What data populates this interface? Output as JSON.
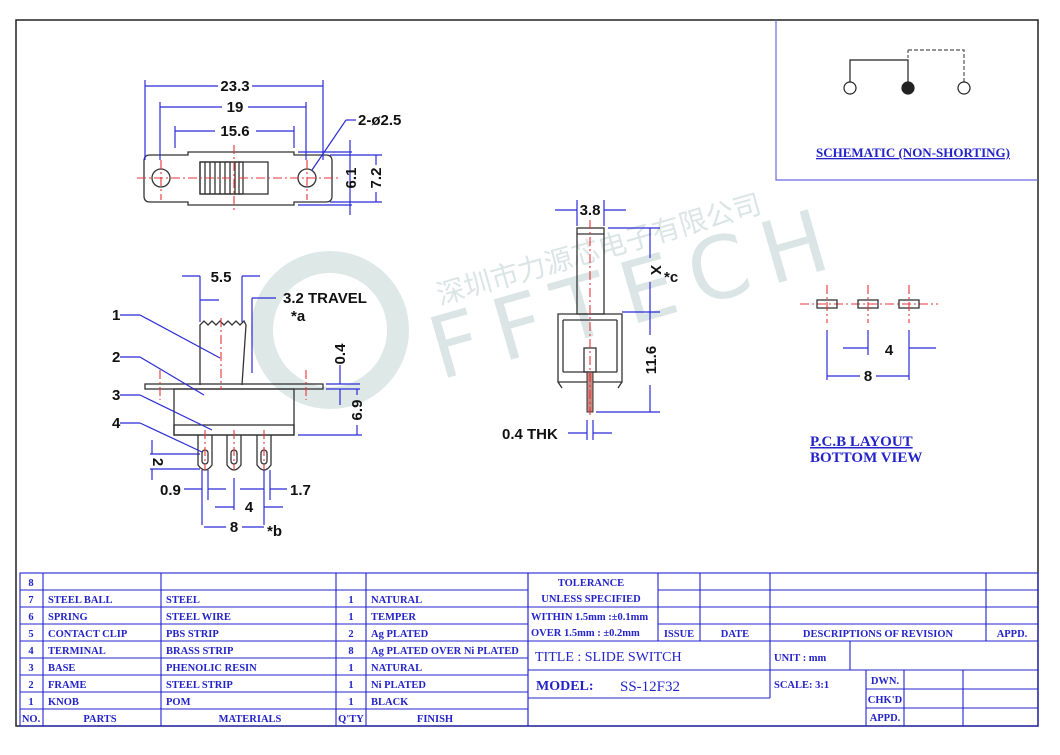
{
  "watermark": {
    "company_cn": "深圳市力源芯电子有限公司",
    "brand": "FFTECH"
  },
  "top_view": {
    "dims": {
      "overall": "23.3",
      "hole_pitch": "19",
      "body": "15.6",
      "holes": "2-ø2.5",
      "height_inner": "6.1",
      "height_outer": "7.2"
    }
  },
  "front_view": {
    "dims": {
      "knob": "5.5",
      "travel": "3.2 TRAVEL",
      "travel_note": "*a",
      "frame_thk": "0.4",
      "body_h": "6.9",
      "pin_len": "2",
      "pin_w": "0.9",
      "pin_gap": "1.7",
      "pitch": "4",
      "span": "8",
      "span_note": "*b"
    },
    "callouts": [
      "1",
      "2",
      "3",
      "4"
    ]
  },
  "side_view": {
    "dims": {
      "knob_w": "3.8",
      "knob_h": "X",
      "knob_note": "*c",
      "height": "11.6",
      "pin_thk": "0.4 THK"
    }
  },
  "schematic": {
    "title": "SCHEMATIC (NON-SHORTING)"
  },
  "pcb_layout": {
    "pitch": "4",
    "span": "8",
    "title_line1": "P.C.B LAYOUT",
    "title_line2": "BOTTOM VIEW"
  },
  "parts_table": {
    "headers": {
      "no": "NO.",
      "parts": "PARTS",
      "materials": "MATERIALS",
      "qty": "Q'TY",
      "finish": "FINISH"
    },
    "rows": [
      {
        "no": "8",
        "part": "",
        "material": "",
        "qty": "",
        "finish": ""
      },
      {
        "no": "7",
        "part": "STEEL BALL",
        "material": "STEEL",
        "qty": "1",
        "finish": "NATURAL"
      },
      {
        "no": "6",
        "part": "SPRING",
        "material": "STEEL WIRE",
        "qty": "1",
        "finish": "TEMPER"
      },
      {
        "no": "5",
        "part": "CONTACT CLIP",
        "material": "PBS STRIP",
        "qty": "2",
        "finish": "Ag PLATED"
      },
      {
        "no": "4",
        "part": "TERMINAL",
        "material": "BRASS STRIP",
        "qty": "8",
        "finish": "Ag PLATED OVER Ni PLATED"
      },
      {
        "no": "3",
        "part": "BASE",
        "material": "PHENOLIC RESIN",
        "qty": "1",
        "finish": "NATURAL"
      },
      {
        "no": "2",
        "part": "FRAME",
        "material": "STEEL STRIP",
        "qty": "1",
        "finish": "Ni PLATED"
      },
      {
        "no": "1",
        "part": "KNOB",
        "material": "POM",
        "qty": "1",
        "finish": "BLACK"
      }
    ]
  },
  "title_block": {
    "tolerance_l1": "TOLERANCE",
    "tolerance_l2": "UNLESS   SPECIFIED",
    "tolerance_l3": "WITHIN 1.5mm :±0.1mm",
    "tolerance_l4": "OVER 1.5mm : ±0.2mm",
    "issue": "ISSUE",
    "date": "DATE",
    "desc_rev": "DESCRIPTIONS OF REVISION",
    "appd": "APPD.",
    "title": "TITLE :  SLIDE SWITCH",
    "unit": "UNIT :  mm",
    "model_label": "MODEL:",
    "model_value": "SS-12F32",
    "scale": "SCALE:  3:1",
    "dwn": "DWN.",
    "chkd": "CHK'D",
    "appd2": "APPD."
  },
  "colors": {
    "dimension": "#2b2bd6",
    "centerline": "#e8333a",
    "table": "#2323d0",
    "outline": "#333333"
  }
}
